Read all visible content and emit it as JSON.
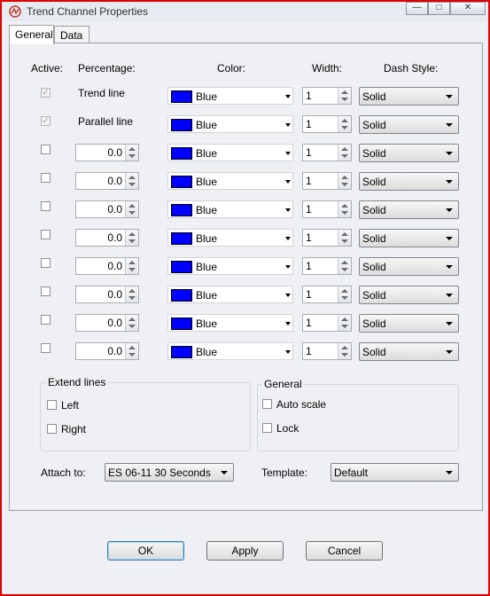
{
  "window": {
    "title": "Trend Channel Properties",
    "minimize_glyph": "—",
    "maximize_glyph": "□",
    "close_glyph": "✕"
  },
  "tabs": [
    {
      "label": "General"
    },
    {
      "label": "Data"
    }
  ],
  "headers": {
    "active": "Active:",
    "percentage": "Percentage:",
    "color": "Color:",
    "width": "Width:",
    "dash_style": "Dash Style:"
  },
  "check_glyph": "✓",
  "rows": [
    {
      "active": true,
      "label": "Trend line",
      "color": "Blue",
      "width": "1",
      "dash": "Solid"
    },
    {
      "active": true,
      "label": "Parallel line",
      "color": "Blue",
      "width": "1",
      "dash": "Solid"
    },
    {
      "active": false,
      "percentage": "0.0",
      "color": "Blue",
      "width": "1",
      "dash": "Solid"
    },
    {
      "active": false,
      "percentage": "0.0",
      "color": "Blue",
      "width": "1",
      "dash": "Solid"
    },
    {
      "active": false,
      "percentage": "0.0",
      "color": "Blue",
      "width": "1",
      "dash": "Solid"
    },
    {
      "active": false,
      "percentage": "0.0",
      "color": "Blue",
      "width": "1",
      "dash": "Solid"
    },
    {
      "active": false,
      "percentage": "0.0",
      "color": "Blue",
      "width": "1",
      "dash": "Solid"
    },
    {
      "active": false,
      "percentage": "0.0",
      "color": "Blue",
      "width": "1",
      "dash": "Solid"
    },
    {
      "active": false,
      "percentage": "0.0",
      "color": "Blue",
      "width": "1",
      "dash": "Solid"
    },
    {
      "active": false,
      "percentage": "0.0",
      "color": "Blue",
      "width": "1",
      "dash": "Solid"
    }
  ],
  "extend_lines": {
    "title": "Extend lines",
    "left": "Left",
    "right": "Right"
  },
  "general_group": {
    "title": "General",
    "auto_scale": "Auto scale",
    "lock": "Lock"
  },
  "attach_to": {
    "label": "Attach to:",
    "value": "ES 06-11 30 Seconds"
  },
  "template": {
    "label": "Template:",
    "value": "Default"
  },
  "buttons": {
    "ok": "OK",
    "apply": "Apply",
    "cancel": "Cancel"
  },
  "colors": {
    "blue_swatch": "#0000ff",
    "window_border": "#e00000"
  }
}
